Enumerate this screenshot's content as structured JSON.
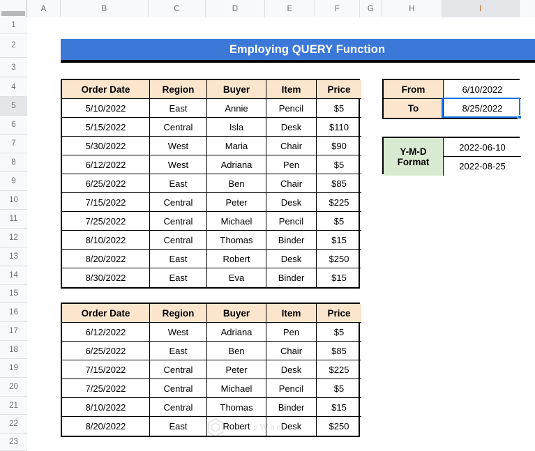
{
  "spreadsheet": {
    "column_headers": [
      "A",
      "B",
      "C",
      "D",
      "E",
      "F",
      "G",
      "H",
      "I"
    ],
    "active_column": "I",
    "row_headers": [
      "1",
      "2",
      "3",
      "4",
      "5",
      "6",
      "7",
      "8",
      "9",
      "10",
      "11",
      "12",
      "13",
      "14",
      "15",
      "16",
      "17",
      "18",
      "19",
      "20",
      "21",
      "22",
      "23"
    ],
    "active_row": "5",
    "colors": {
      "banner_background": "#3c78d8",
      "banner_text": "#ffffff",
      "header_fill_orange": "#fce5cd",
      "header_fill_green": "#d9ead3",
      "grid_line": "#000000",
      "active_cell_border": "#1a73e8",
      "sheet_background": "#ffffff"
    }
  },
  "banner": {
    "title": "Employing QUERY Function"
  },
  "source_table": {
    "columns": [
      "Order Date",
      "Region",
      "Buyer",
      "Item",
      "Price"
    ],
    "rows": [
      [
        "5/10/2022",
        "East",
        "Annie",
        "Pencil",
        "$5"
      ],
      [
        "5/15/2022",
        "Central",
        "Isla",
        "Desk",
        "$110"
      ],
      [
        "5/30/2022",
        "West",
        "Maria",
        "Chair",
        "$90"
      ],
      [
        "6/12/2022",
        "West",
        "Adriana",
        "Pen",
        "$5"
      ],
      [
        "6/25/2022",
        "East",
        "Ben",
        "Chair",
        "$85"
      ],
      [
        "7/15/2022",
        "Central",
        "Peter",
        "Desk",
        "$225"
      ],
      [
        "7/25/2022",
        "Central",
        "Michael",
        "Pencil",
        "$5"
      ],
      [
        "8/10/2022",
        "Central",
        "Thomas",
        "Binder",
        "$15"
      ],
      [
        "8/20/2022",
        "East",
        "Robert",
        "Desk",
        "$250"
      ],
      [
        "8/30/2022",
        "East",
        "Eva",
        "Binder",
        "$15"
      ]
    ]
  },
  "result_table": {
    "columns": [
      "Order Date",
      "Region",
      "Buyer",
      "Item",
      "Price"
    ],
    "rows": [
      [
        "6/12/2022",
        "West",
        "Adriana",
        "Pen",
        "$5"
      ],
      [
        "6/25/2022",
        "East",
        "Ben",
        "Chair",
        "$85"
      ],
      [
        "7/15/2022",
        "Central",
        "Peter",
        "Desk",
        "$225"
      ],
      [
        "7/25/2022",
        "Central",
        "Michael",
        "Pencil",
        "$5"
      ],
      [
        "8/10/2022",
        "Central",
        "Thomas",
        "Binder",
        "$15"
      ],
      [
        "8/20/2022",
        "East",
        "Robert",
        "Desk",
        "$250"
      ]
    ]
  },
  "date_range_panel": {
    "from_label": "From",
    "from_value": "6/10/2022",
    "to_label": "To",
    "to_value": "8/25/2022"
  },
  "ymd_panel": {
    "label_line1": "Y-M-D",
    "label_line2": "Format",
    "from_value": "2022-06-10",
    "to_value": "2022-08-25"
  },
  "watermark": {
    "text": "officeWheel"
  }
}
